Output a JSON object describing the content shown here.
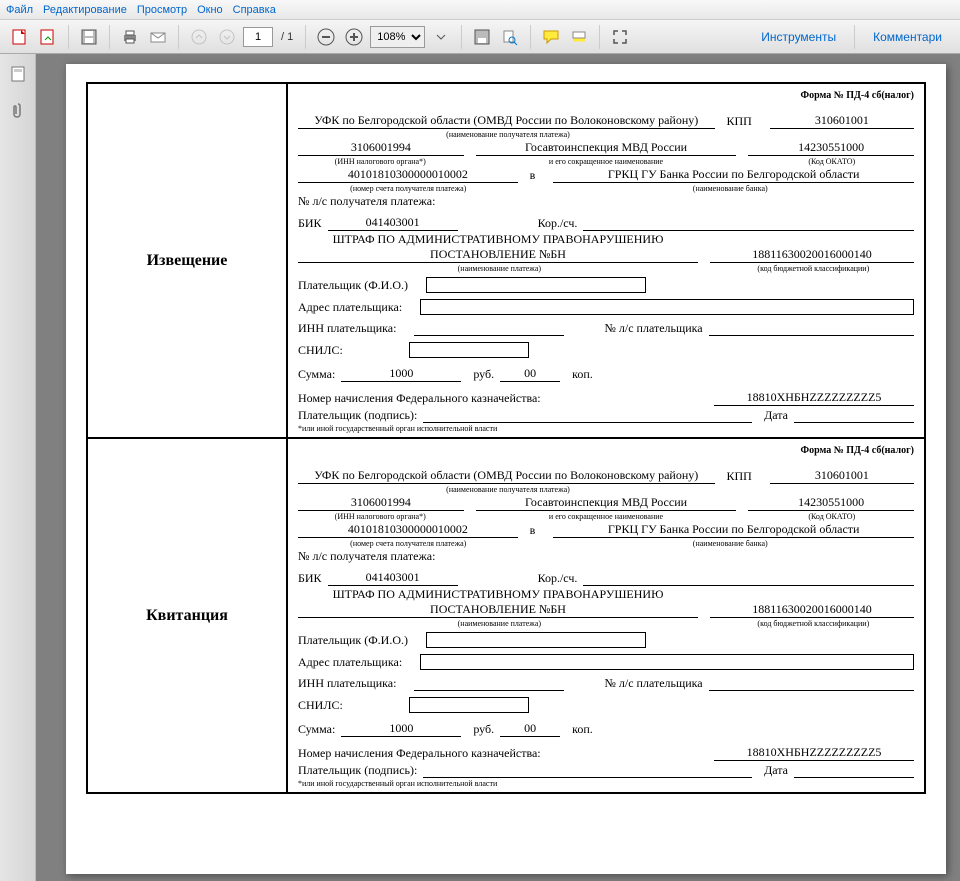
{
  "menu": {
    "file": "Файл",
    "edit": "Редактирование",
    "view": "Просмотр",
    "window": "Окно",
    "help": "Справка"
  },
  "toolbar": {
    "page_current": "1",
    "page_total": "/ 1",
    "zoom": "108%",
    "tools": "Инструменты",
    "comments": "Комментари"
  },
  "form": {
    "title_notice": "Извещение",
    "title_receipt": "Квитанция",
    "header": "Форма № ПД-4 сб(налог)",
    "recipient": "УФК по Белгородской области (ОМВД России по Волоконовскому району)",
    "recipient_cap": "(наименование получателя платежа)",
    "kpp_lbl": "КПП",
    "kpp": "310601001",
    "inn": "3106001994",
    "inn_cap": "(ИНН налогового органа*)",
    "gai": "Госавтоинспекция МВД России",
    "gai_cap": "и его сокращенное наименование",
    "okato": "14230551000",
    "okato_cap": "(Код ОКАТО)",
    "account": "40101810300000010002",
    "account_cap": "(номер счета получателя платежа)",
    "in_word": "в",
    "bank": "ГРКЦ ГУ Банка России по Белгородской области",
    "bank_cap": "(наименование банка)",
    "ls_lbl": "№ л/с получателя платежа:",
    "bik_lbl": "БИК",
    "bik": "041403001",
    "kor_lbl": "Кор./сч.",
    "payment_name": "ШТРАФ ПО АДМИНИСТРАТИВНОМУ ПРАВОНАРУШЕНИЮ ПОСТАНОВЛЕНИЕ №БН",
    "payment_cap": "(наименование платежа)",
    "kbk": "18811630020016000140",
    "kbk_cap": "(код бюджетной классификации)",
    "payer_fio_lbl": "Плательщик (Ф.И.О.)",
    "payer_addr_lbl": "Адрес плательщика:",
    "payer_inn_lbl": "ИНН плательщика:",
    "payer_ls_lbl": "№ л/с плательщика",
    "snils_lbl": "СНИЛС:",
    "sum_lbl": "Сумма:",
    "sum_val": "1000",
    "sum_rub": "руб.",
    "sum_kop_val": "00",
    "sum_kop": "коп.",
    "treasury_lbl": "Номер начисления Федерального казначейства:",
    "treasury_val": "18810ХНБНZZZZZZZZZ5",
    "sign_lbl": "Плательщик (подпись):",
    "date_lbl": "Дата",
    "footnote": "*или иной государственный орган исполнительной власти"
  }
}
